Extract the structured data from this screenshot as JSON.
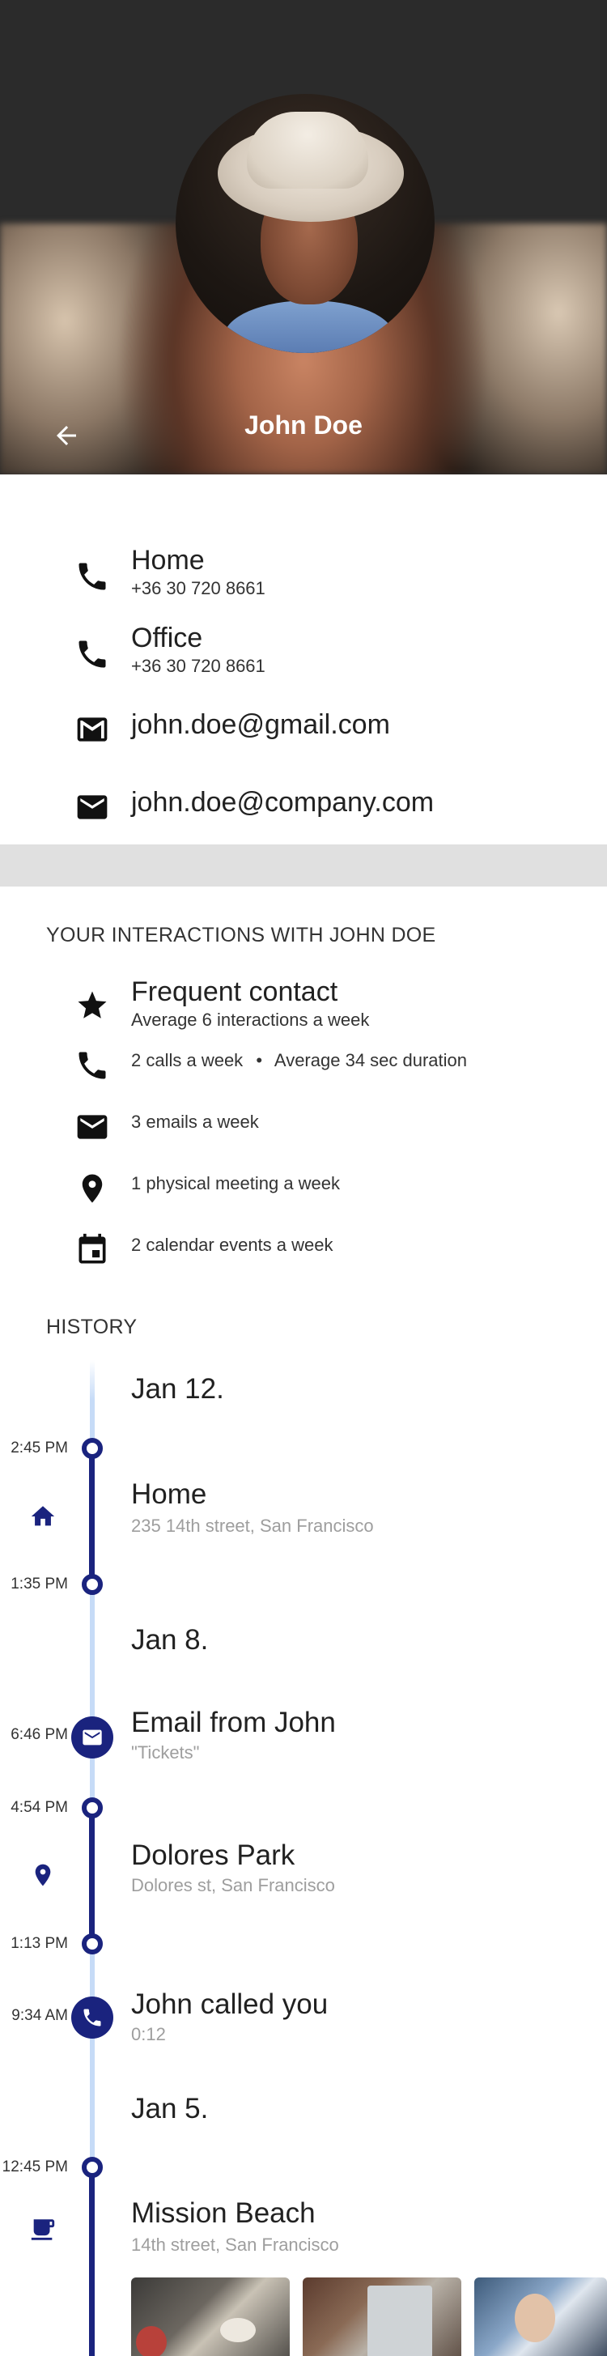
{
  "header": {
    "name": "John Doe",
    "back_icon": "arrow-left-icon"
  },
  "contacts": {
    "phones": [
      {
        "label": "Home",
        "number": "+36 30 720 8661",
        "icon": "phone-icon"
      },
      {
        "label": "Office",
        "number": "+36 30 720 8661",
        "icon": "phone-icon"
      }
    ],
    "emails": [
      {
        "address": "john.doe@gmail.com",
        "icon": "gmail-icon"
      },
      {
        "address": "john.doe@company.com",
        "icon": "email-icon"
      }
    ]
  },
  "interactions": {
    "title": "YOUR INTERACTIONS WITH JOHN DOE",
    "frequent_title": "Frequent contact",
    "frequent_sub": "Average 6 interactions a week",
    "calls": "2 calls a week",
    "separator": "•",
    "duration": "Average 34 sec duration",
    "emails": "3 emails a week",
    "meetings": "1 physical meeting a week",
    "calendar": "2 calendar events a week"
  },
  "history": {
    "title": "HISTORY",
    "dates": [
      "Jan 12.",
      "Jan 8.",
      "Jan 5."
    ],
    "events": [
      {
        "title": "Home",
        "subtitle": "235 14th street, San Francisco",
        "time_start": "2:45 PM",
        "time_end": "1:35 PM",
        "icon": "home-icon"
      },
      {
        "title": "Email from John",
        "subtitle": "\"Tickets\"",
        "time": "6:46 PM",
        "icon": "email-icon"
      },
      {
        "title": "Dolores Park",
        "subtitle": "Dolores st, San Francisco",
        "time_start": "4:54 PM",
        "time_end": "1:13 PM",
        "icon": "location-pin-icon"
      },
      {
        "title": "John called you",
        "subtitle": "0:12",
        "time": "9:34 AM",
        "icon": "phone-icon"
      },
      {
        "title": "Mission Beach",
        "subtitle": "14th street, San Francisco",
        "time_start": "12:45 PM",
        "icon": "coffee-icon"
      }
    ]
  },
  "colors": {
    "accent": "#1a237e",
    "timeline_light": "#c6dbf7",
    "divider": "#e0e0e0"
  }
}
